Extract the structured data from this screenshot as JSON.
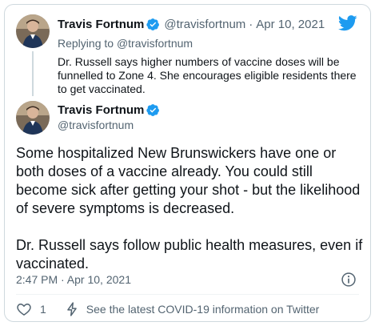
{
  "parent_tweet": {
    "author_name": "Travis Fortnum",
    "handle": "@travisfortnum",
    "separator": "·",
    "date": "Apr 10, 2021",
    "replying_prefix": "Replying to",
    "replying_to": "@travisfortnum",
    "text": "Dr. Russell says higher numbers of vaccine doses will be funnelled to Zone 4. She encourages eligible residents there to get vaccinated."
  },
  "main_tweet": {
    "author_name": "Travis Fortnum",
    "handle": "@travisfortnum",
    "paragraphs": [
      "Some hospitalized New Brunswickers have one or both doses of a vaccine already. You could still become sick after getting your shot - but the likelihood of severe symptoms is decreased.",
      "Dr. Russell says follow public health measures, even if vaccinated."
    ],
    "timestamp": "2:47 PM · Apr 10, 2021"
  },
  "footer": {
    "like_count": "1",
    "covid_info_link": "See the latest COVID-19 information on Twitter"
  },
  "icons": {
    "brand": "twitter-bird-icon",
    "verified": "verified-badge-icon",
    "info": "info-icon",
    "like": "heart-icon",
    "covid": "bolt-icon"
  },
  "colors": {
    "brand_blue": "#1d9bf0",
    "text_primary": "#0f1419",
    "text_secondary": "#536471",
    "border": "#cfd9de"
  }
}
